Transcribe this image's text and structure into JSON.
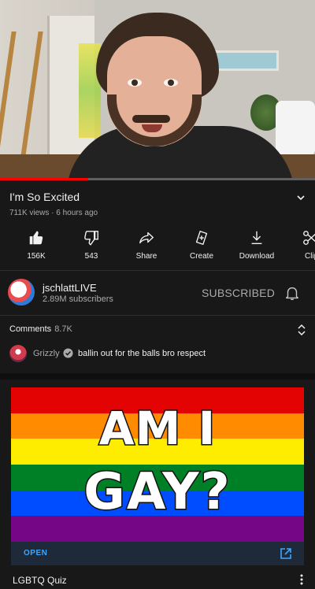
{
  "video": {
    "progress_fraction": 0.28
  },
  "info": {
    "title": "I'm So Excited",
    "meta": "711K views · 6 hours ago"
  },
  "actions": [
    {
      "label": "156K",
      "icon": "like-icon"
    },
    {
      "label": "543",
      "icon": "dislike-icon"
    },
    {
      "label": "Share",
      "icon": "share-icon"
    },
    {
      "label": "Create",
      "icon": "create-icon"
    },
    {
      "label": "Download",
      "icon": "download-icon"
    },
    {
      "label": "Clip",
      "icon": "clip-icon"
    }
  ],
  "channel": {
    "name": "jschlattLIVE",
    "subscribers": "2.89M subscribers",
    "subscribe_status": "SUBSCRIBED"
  },
  "comments": {
    "heading": "Comments",
    "count": "8.7K",
    "top_comment": {
      "user": "Grizzly",
      "text": "ballin out for the balls bro respect"
    }
  },
  "ad": {
    "headline_line1": "AM I",
    "headline_line2": "GAY?",
    "cta": "OPEN",
    "title": "LGBTQ Quiz",
    "stripe_colors": [
      "#e40303",
      "#ff8c00",
      "#ffed00",
      "#008026",
      "#004dff",
      "#750787"
    ]
  },
  "colors": {
    "accent_red": "#ff0000",
    "link_blue": "#3ea6ff",
    "background": "#181818"
  }
}
